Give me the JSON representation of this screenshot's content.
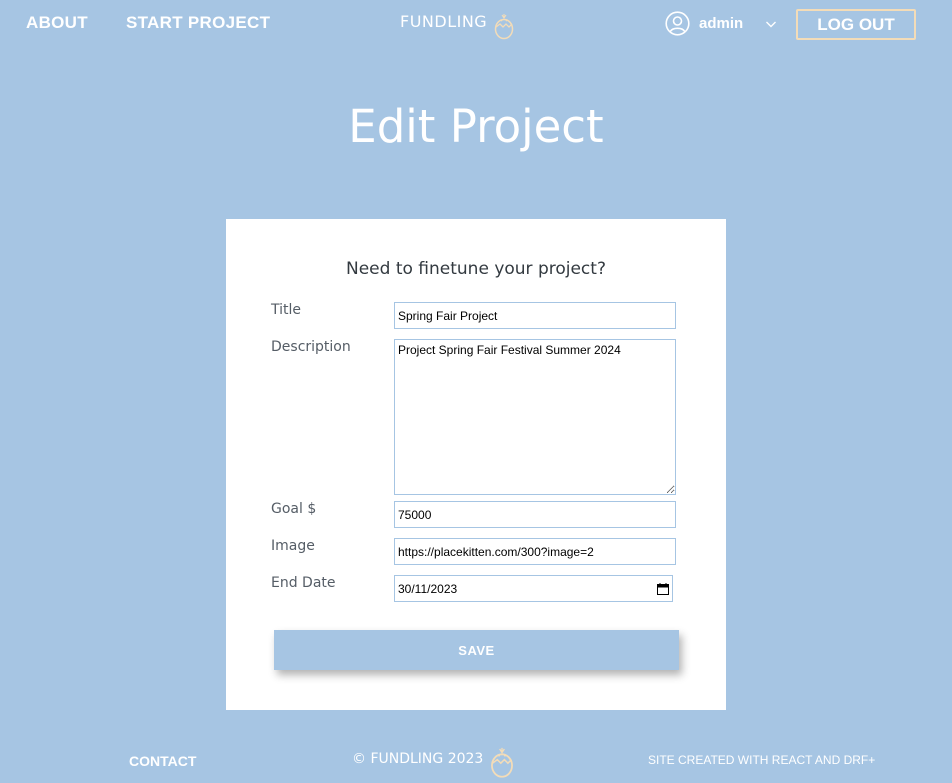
{
  "nav": {
    "about": "ABOUT",
    "start_project": "START PROJECT",
    "brand": "FUNDLING",
    "username": "admin",
    "logout": "LOG OUT"
  },
  "page": {
    "title": "Edit Project",
    "subtitle": "Need to finetune your project?"
  },
  "form": {
    "title_label": "Title",
    "title_value": "Spring Fair Project",
    "description_label": "Description",
    "description_value": "Project Spring Fair Festival Summer 2024",
    "goal_label": "Goal $",
    "goal_value": "75000",
    "image_label": "Image",
    "image_value": "https://placekitten.com/300?image=2",
    "end_date_label": "End Date",
    "end_date_value": "30/11/2023",
    "save_label": "SAVE"
  },
  "footer": {
    "contact": "CONTACT",
    "copyright": "© FUNDLING 2023",
    "credit": "SITE CREATED WITH REACT AND DRF+"
  },
  "colors": {
    "background": "#a6c5e3",
    "logout_border": "#f3dcb8",
    "egg_outline": "#f3dcb8"
  },
  "icons": {
    "brand": "egg-icon",
    "user": "user-icon",
    "dropdown": "chevron-down-icon",
    "date_picker": "calendar-icon",
    "footer": "egg-icon"
  }
}
